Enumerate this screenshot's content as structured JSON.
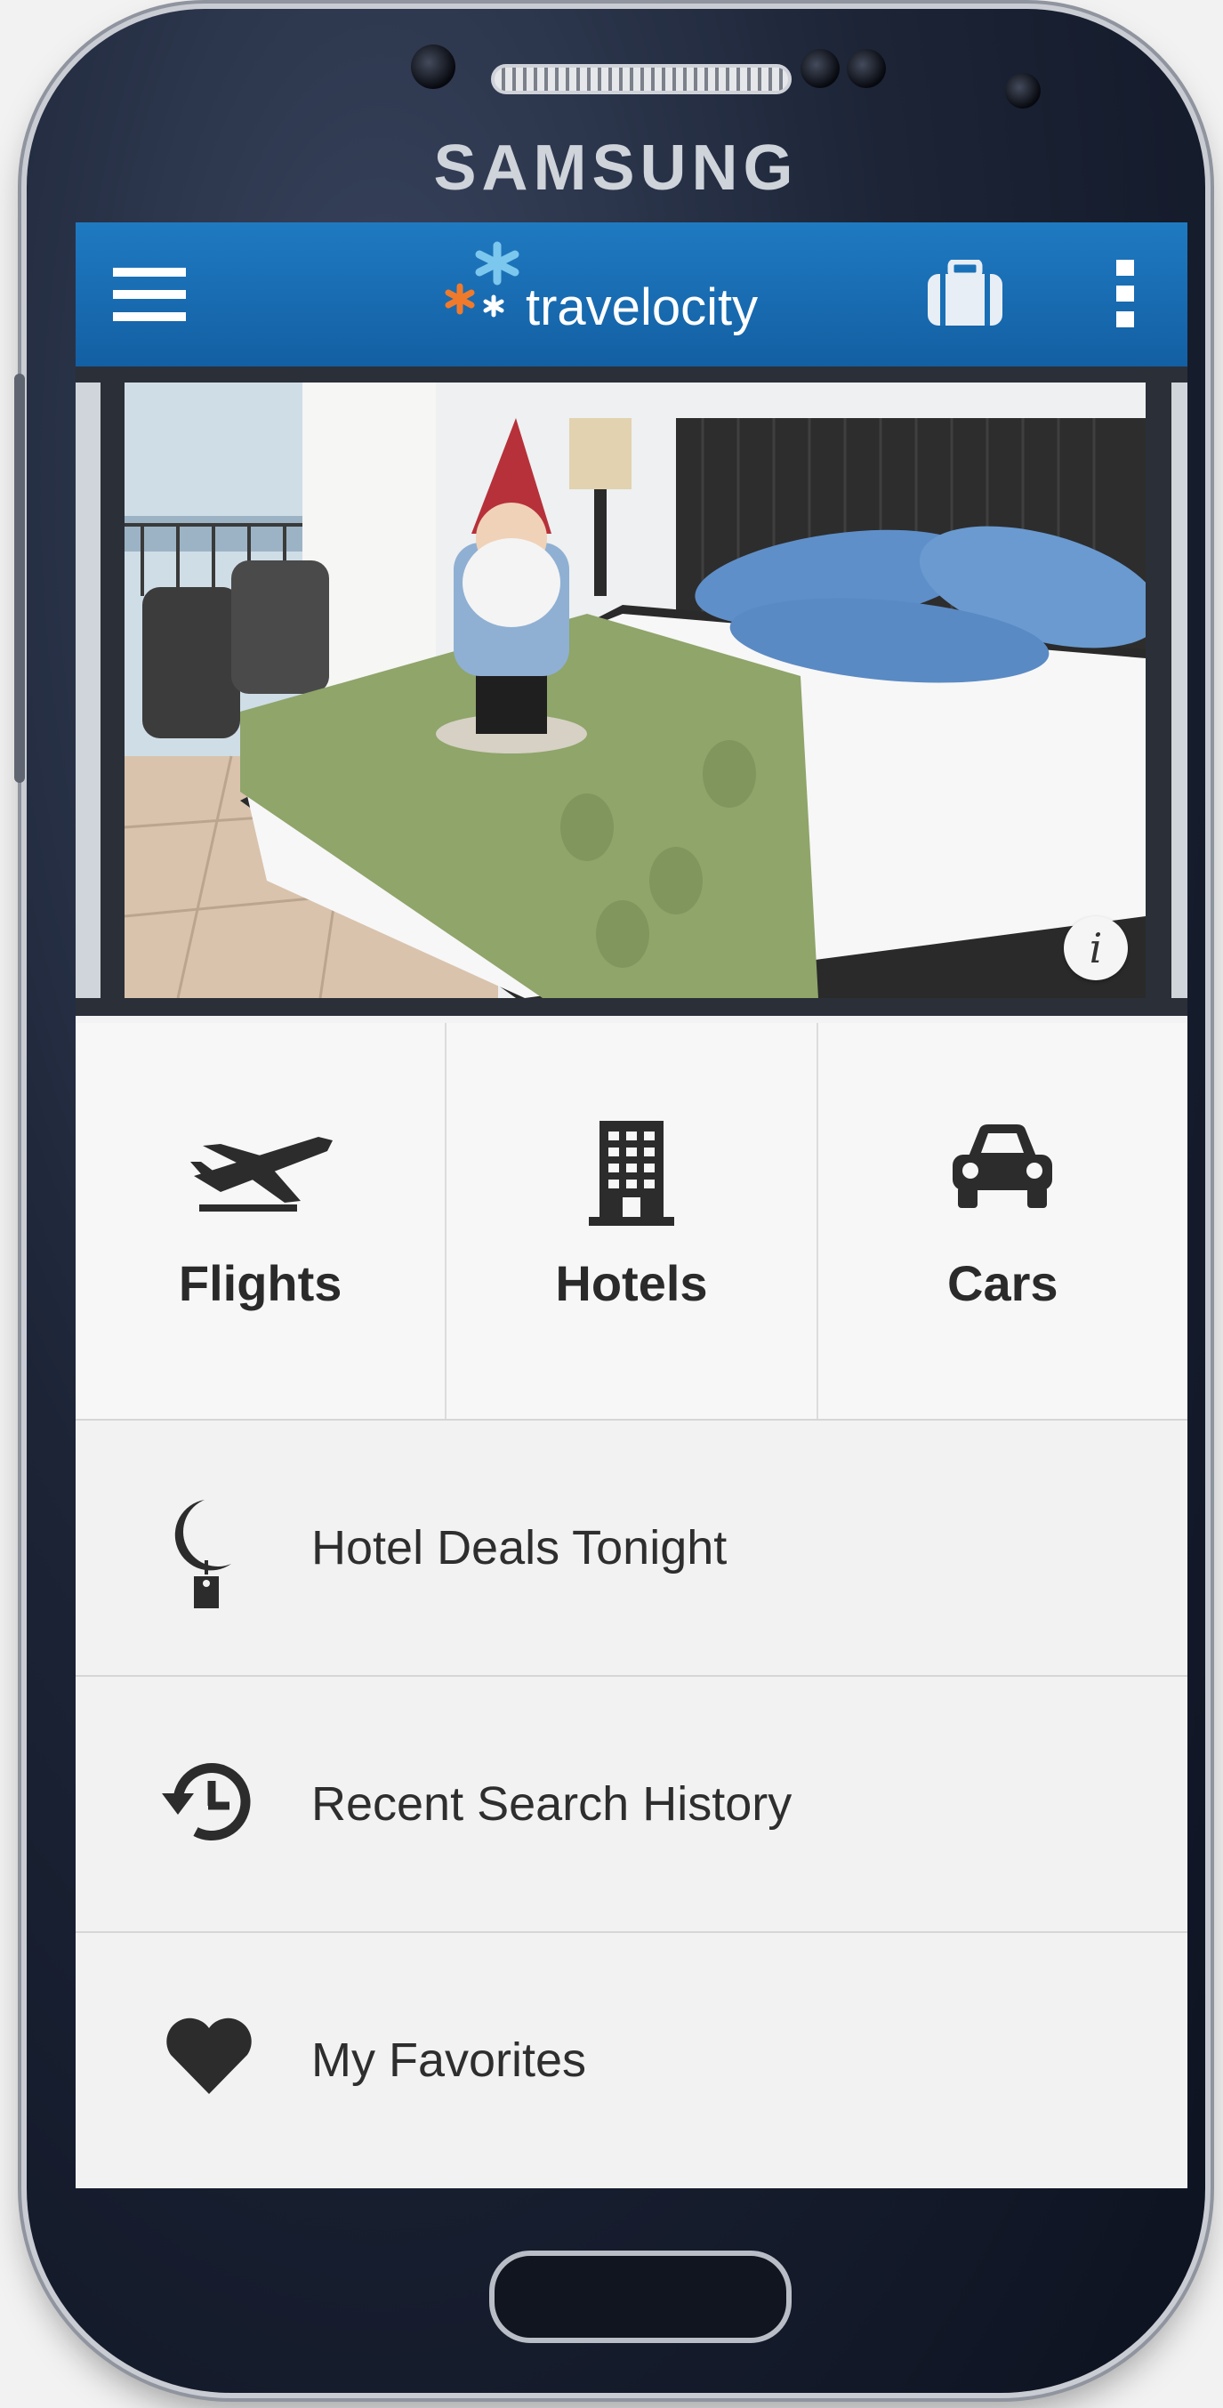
{
  "device": {
    "brand": "SAMSUNG"
  },
  "appbar": {
    "logo_text": "travelocity",
    "menu_icon": "hamburger-menu-icon",
    "trips_icon": "briefcase-icon",
    "overflow_icon": "more-vert-icon"
  },
  "hero": {
    "info_label": "i"
  },
  "tiles": [
    {
      "label": "Flights",
      "icon": "airplane-icon"
    },
    {
      "label": "Hotels",
      "icon": "hotel-building-icon"
    },
    {
      "label": "Cars",
      "icon": "car-icon"
    }
  ],
  "list": [
    {
      "label": "Hotel Deals Tonight",
      "icon": "moon-tag-icon"
    },
    {
      "label": "Recent Search History",
      "icon": "history-clock-icon"
    },
    {
      "label": "My Favorites",
      "icon": "heart-icon"
    }
  ],
  "colors": {
    "appbar": "#1a6fb5",
    "text": "#2a2a2a",
    "accent_star_orange": "#f07a2b",
    "accent_star_blue": "#7cc7ee"
  }
}
